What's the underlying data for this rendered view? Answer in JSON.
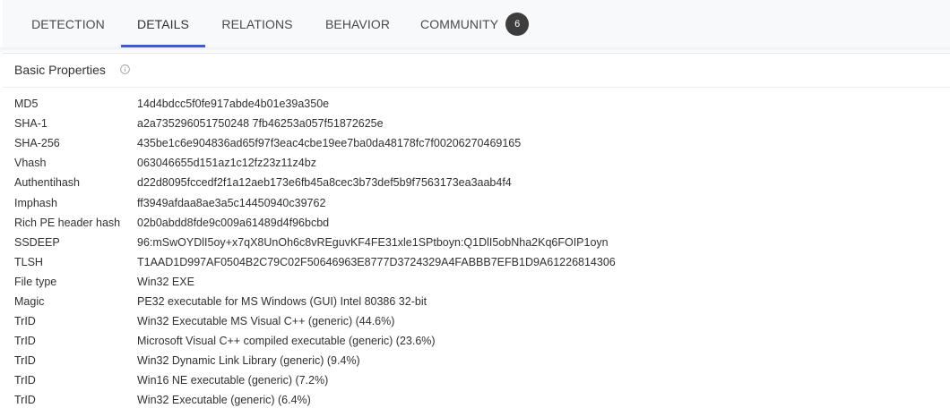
{
  "tabs": [
    {
      "label": "DETECTION"
    },
    {
      "label": "DETAILS"
    },
    {
      "label": "RELATIONS"
    },
    {
      "label": "BEHAVIOR"
    },
    {
      "label": "COMMUNITY",
      "badge": "6"
    }
  ],
  "active_tab": "DETAILS",
  "colors": {
    "accent": "#4056e0",
    "badge_bg": "#3d3d3d"
  },
  "section": {
    "title": "Basic Properties",
    "info_icon": "info-circle-icon"
  },
  "properties": [
    {
      "key": "MD5",
      "value": "14d4bdcc5f0fe917abde4b01e39a350e"
    },
    {
      "key": "SHA-1",
      "value": "a2a735296051750248 7fb46253a057f51872625e"
    },
    {
      "key": "SHA-256",
      "value": "435be1c6e904836ad65f97f3eac4cbe19ee7ba0da48178fc7f00206270469165"
    },
    {
      "key": "Vhash",
      "value": "063046655d151az1c12fz23z11z4bz"
    },
    {
      "key": "Authentihash",
      "value": "d22d8095fccedf2f1a12aeb173e6fb45a8cec3b73def5b9f7563173ea3aab4f4"
    },
    {
      "key": "Imphash",
      "value": "ff3949afdaa8ae3a5c14450940c39762"
    },
    {
      "key": "Rich PE header hash",
      "value": "02b0abdd8fde9c009a61489d4f96bcbd"
    },
    {
      "key": "SSDEEP",
      "value": "96:mSwOYDlI5oy+x7qX8UnOh6c8vREguvKF4FE31xle1SPtboyn:Q1DlI5obNha2Kq6FOIP1oyn"
    },
    {
      "key": "TLSH",
      "value": "T1AAD1D997AF0504B2C79C02F50646963E8777D3724329A4FABBB7EFB1D9A61226814306"
    },
    {
      "key": "File type",
      "value": "Win32 EXE"
    },
    {
      "key": "Magic",
      "value": "PE32 executable for MS Windows (GUI) Intel 80386 32-bit"
    },
    {
      "key": "TrID",
      "value": "Win32 Executable MS Visual C++ (generic) (44.6%)"
    },
    {
      "key": "TrID",
      "value": "Microsoft Visual C++ compiled executable (generic) (23.6%)"
    },
    {
      "key": "TrID",
      "value": "Win32 Dynamic Link Library (generic) (9.4%)"
    },
    {
      "key": "TrID",
      "value": "Win16 NE executable (generic) (7.2%)"
    },
    {
      "key": "TrID",
      "value": "Win32 Executable (generic) (6.4%)"
    }
  ]
}
